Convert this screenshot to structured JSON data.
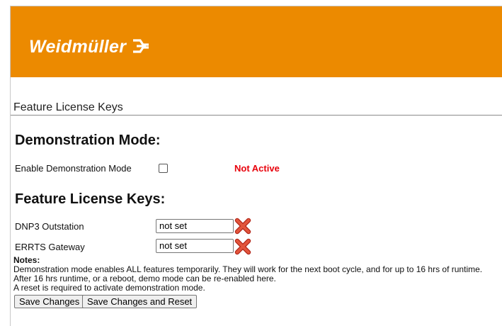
{
  "header": {
    "brand": "Weidmüller",
    "brand_color": "#ec8a00"
  },
  "page": {
    "title": "Feature License Keys"
  },
  "demo": {
    "heading": "Demonstration Mode:",
    "enable_label": "Enable Demonstration Mode",
    "enabled": false,
    "status": "Not Active",
    "status_color": "#e8000b"
  },
  "keys": {
    "heading": "Feature License Keys:",
    "items": [
      {
        "label": "DNP3 Outstation",
        "value": "not set",
        "icon": "red-x-icon"
      },
      {
        "label": "ERRTS Gateway",
        "value": "not set",
        "icon": "red-x-icon"
      }
    ]
  },
  "notes": {
    "title": "Notes:",
    "lines": [
      "Demonstration mode enables ALL features temporarily. They will work for the next boot cycle, and for up to 16 hrs of runtime.",
      "After 16 hrs runtime, or a reboot, demo mode can be re-enabled here.",
      "A reset is required to activate demonstration mode."
    ]
  },
  "actions": {
    "save_label": "Save Changes",
    "save_reset_label": "Save Changes and Reset"
  }
}
